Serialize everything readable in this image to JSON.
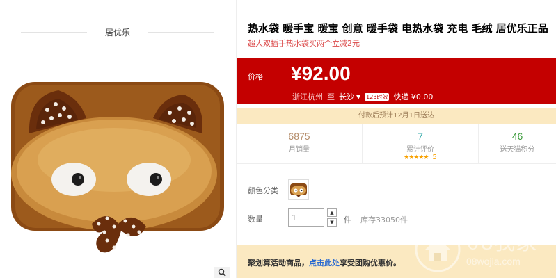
{
  "store": {
    "name": "居优乐"
  },
  "product": {
    "title": "热水袋 暖手宝 暖宝 创意 暖手袋 电热水袋 充电 毛绒 居优乐正品",
    "subtitle": "超大双插手热水袋买两个立减2元",
    "image_icon": "plush-bear-hand-warmer"
  },
  "price": {
    "label": "价格",
    "value": "¥92.00",
    "ship_from": "浙江杭州",
    "to_word": "至",
    "destination": "长沙",
    "badge": "123时效",
    "shipping": "快递 ¥0.00"
  },
  "notice": "付款后预计12月1日送达",
  "stats": {
    "monthly_sales": {
      "value": "6875",
      "label": "月销量"
    },
    "reviews": {
      "value": "7",
      "label": "累计评价",
      "stars": "★★★★★",
      "star_count": "5"
    },
    "tmall_points": {
      "value": "46",
      "label": "送天猫积分"
    }
  },
  "options": {
    "color_label": "颜色分类",
    "qty_label": "数量",
    "qty_value": "1",
    "unit": "件",
    "stock": "库存33050件"
  },
  "promo": {
    "prefix": "聚划算活动商品，",
    "link": "点击此处",
    "suffix": "享受团购优惠价。"
  },
  "watermark": {
    "big": "08我家",
    "small": "08wojia.com"
  },
  "colors": {
    "price_bg": "#c40000",
    "notice_bg": "#fbe9c1",
    "link": "#2a6ad0",
    "stars": "#f8a100"
  }
}
